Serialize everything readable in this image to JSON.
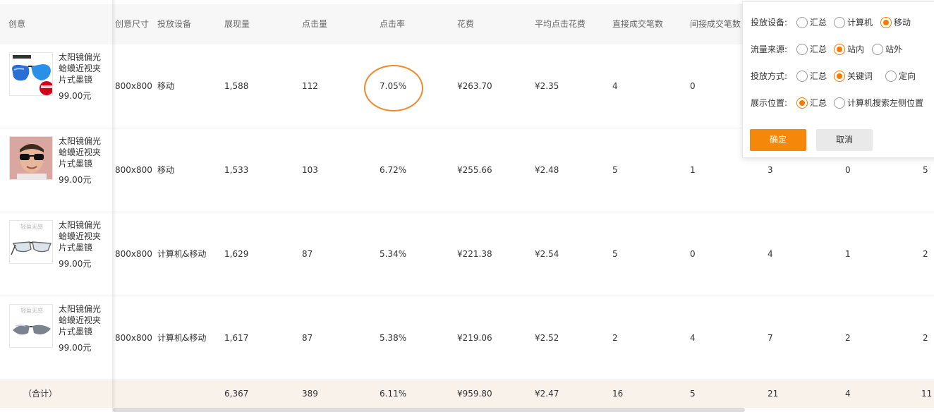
{
  "table": {
    "headers": {
      "creative": "创意",
      "size": "创意尺寸",
      "device": "投放设备",
      "impressions": "展现量",
      "clicks": "点击量",
      "ctr": "点击率",
      "cost": "花费",
      "cpc": "平均点击花费",
      "direct_orders": "直接成交笔数",
      "indirect_orders": "间接成交笔数"
    },
    "rows": [
      {
        "name": "太阳镜偏光蛤蟆近视夹片式墨镜",
        "price": "99.00元",
        "size": "800x800",
        "device": "移动",
        "impressions": "1,588",
        "clicks": "112",
        "ctr": "7.05%",
        "cost": "¥263.70",
        "cpc": "¥2.35",
        "direct_orders": "4",
        "indirect_orders": "0",
        "c11": "",
        "c12": "",
        "c13": ""
      },
      {
        "name": "太阳镜偏光蛤蟆近视夹片式墨镜",
        "price": "99.00元",
        "size": "800x800",
        "device": "移动",
        "impressions": "1,533",
        "clicks": "103",
        "ctr": "6.72%",
        "cost": "¥255.66",
        "cpc": "¥2.48",
        "direct_orders": "5",
        "indirect_orders": "1",
        "c11": "3",
        "c12": "0",
        "c13": "5"
      },
      {
        "name": "太阳镜偏光蛤蟆近视夹片式墨镜",
        "price": "99.00元",
        "size": "800x800",
        "device": "计算机&移动",
        "impressions": "1,629",
        "clicks": "87",
        "ctr": "5.34%",
        "cost": "¥221.38",
        "cpc": "¥2.54",
        "direct_orders": "5",
        "indirect_orders": "0",
        "c11": "4",
        "c12": "1",
        "c13": "2"
      },
      {
        "name": "太阳镜偏光蛤蟆近视夹片式墨镜",
        "price": "99.00元",
        "size": "800x800",
        "device": "计算机&移动",
        "impressions": "1,617",
        "clicks": "87",
        "ctr": "5.38%",
        "cost": "¥219.06",
        "cpc": "¥2.52",
        "direct_orders": "2",
        "indirect_orders": "4",
        "c11": "7",
        "c12": "2",
        "c13": "2"
      }
    ],
    "total": {
      "label": "（合计）",
      "impressions": "6,367",
      "clicks": "389",
      "ctr": "6.11%",
      "cost": "¥959.80",
      "cpc": "¥2.47",
      "direct_orders": "16",
      "indirect_orders": "5",
      "c11": "21",
      "c12": "4",
      "c13": "11"
    },
    "thumb_texts": {
      "brand": "轻盈无感"
    }
  },
  "filter": {
    "device": {
      "label": "投放设备:",
      "options": [
        "汇总",
        "计算机",
        "移动"
      ],
      "selected": "移动"
    },
    "traffic": {
      "label": "流量来源:",
      "options": [
        "汇总",
        "站内",
        "站外"
      ],
      "selected": "站内"
    },
    "method": {
      "label": "投放方式:",
      "options": [
        "汇总",
        "关键词",
        "定向"
      ],
      "selected": "关键词"
    },
    "position": {
      "label": "展示位置:",
      "options": [
        "汇总",
        "计算机搜索左侧位置"
      ],
      "selected": "汇总"
    },
    "confirm": "确定",
    "cancel": "取消"
  },
  "colors": {
    "accent": "#f5880a",
    "highlight_ring": "#f08a2c",
    "total_bg": "#f9f2ea"
  }
}
